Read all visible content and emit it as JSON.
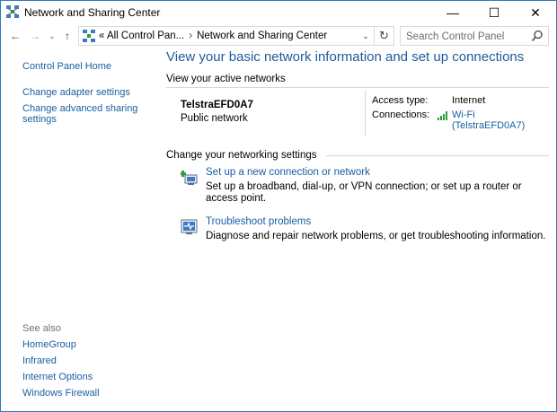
{
  "window": {
    "title": "Network and Sharing Center",
    "min_glyph": "—",
    "max_glyph": "☐",
    "close_glyph": "✕"
  },
  "nav": {
    "back_glyph": "←",
    "forward_glyph": "→",
    "recent_glyph": "⌄",
    "up_glyph": "↑",
    "breadcrumbs": [
      "« All Control Pan...",
      "Network and Sharing Center"
    ],
    "crumb_separator": "›",
    "dropdown_glyph": "⌄",
    "refresh_glyph": "↻",
    "search_placeholder": "Search Control Panel"
  },
  "sidebar": {
    "home": "Control Panel Home",
    "items": [
      "Change adapter settings",
      "Change advanced sharing settings"
    ],
    "see_also_label": "See also",
    "see_also": [
      "HomeGroup",
      "Infrared",
      "Internet Options",
      "Windows Firewall"
    ]
  },
  "main": {
    "heading": "View your basic network information and set up connections",
    "active_networks_label": "View your active networks",
    "network": {
      "name": "TelstraEFD0A7",
      "type": "Public network",
      "access_type_label": "Access type:",
      "access_type_value": "Internet",
      "connections_label": "Connections:",
      "connection_line1": "Wi-Fi",
      "connection_line2": "(TelstraEFD0A7)"
    },
    "change_settings_label": "Change your networking settings",
    "tasks": [
      {
        "link": "Set up a new connection or network",
        "desc": "Set up a broadband, dial-up, or VPN connection; or set up a router or access point."
      },
      {
        "link": "Troubleshoot problems",
        "desc": "Diagnose and repair network problems, or get troubleshooting information."
      }
    ]
  },
  "colors": {
    "accent_link": "#1a5ea3",
    "heading": "#1e5a9c",
    "window_border": "#2b79c2"
  }
}
